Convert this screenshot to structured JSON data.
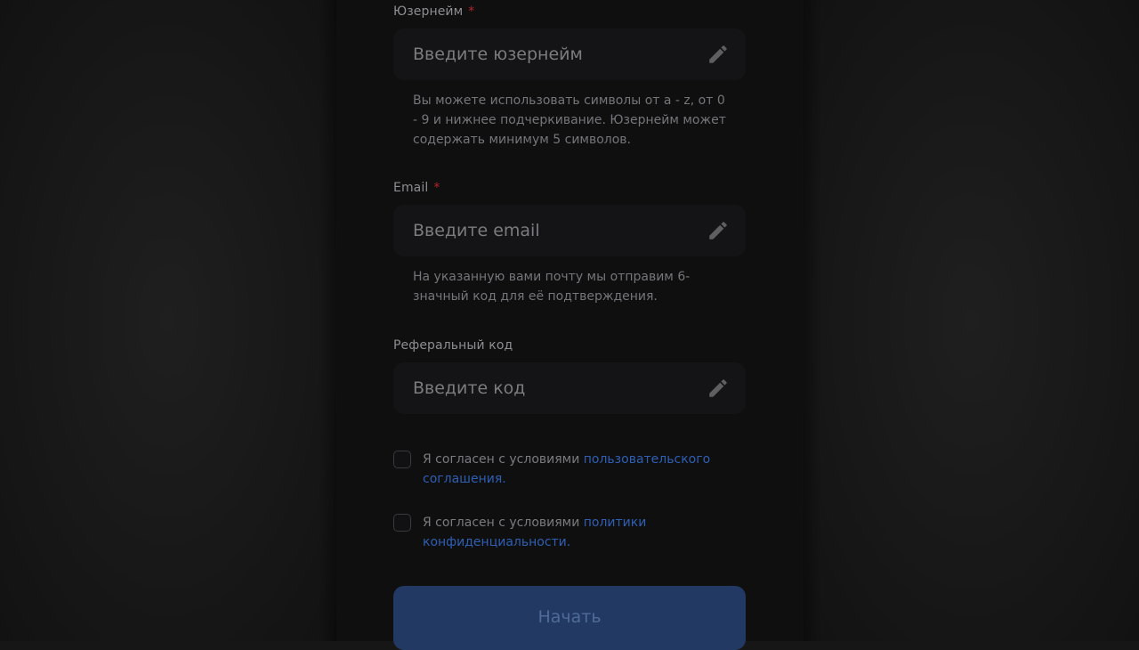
{
  "form": {
    "username": {
      "label": "Юзернейм",
      "required_mark": "*",
      "placeholder": "Введите юзернейм",
      "hint": "Вы можете использовать символы от a - z, от 0 - 9 и нижнее подчеркивание. Юзернейм может содержать минимум 5 символов.",
      "icon": "pencil-icon"
    },
    "email": {
      "label": "Email",
      "required_mark": "*",
      "placeholder": "Введите email",
      "hint": "На указанную вами почту мы отправим 6-значный код для её подтверждения.",
      "icon": "pencil-icon"
    },
    "referral": {
      "label": "Реферальный код",
      "placeholder": "Введите код",
      "icon": "pencil-icon"
    }
  },
  "agreements": [
    {
      "text": "Я согласен с условиями",
      "link_text": "пользовательского соглашения.",
      "checked": false
    },
    {
      "text": "Я согласен с условиями",
      "link_text": "политики конфиденциальности.",
      "checked": false
    }
  ],
  "submit": {
    "label": "Начать",
    "enabled": false
  },
  "colors": {
    "required": "#b3262b",
    "link": "#2f5fb3",
    "button_bg": "#223a63",
    "button_text": "#4f6b97"
  }
}
